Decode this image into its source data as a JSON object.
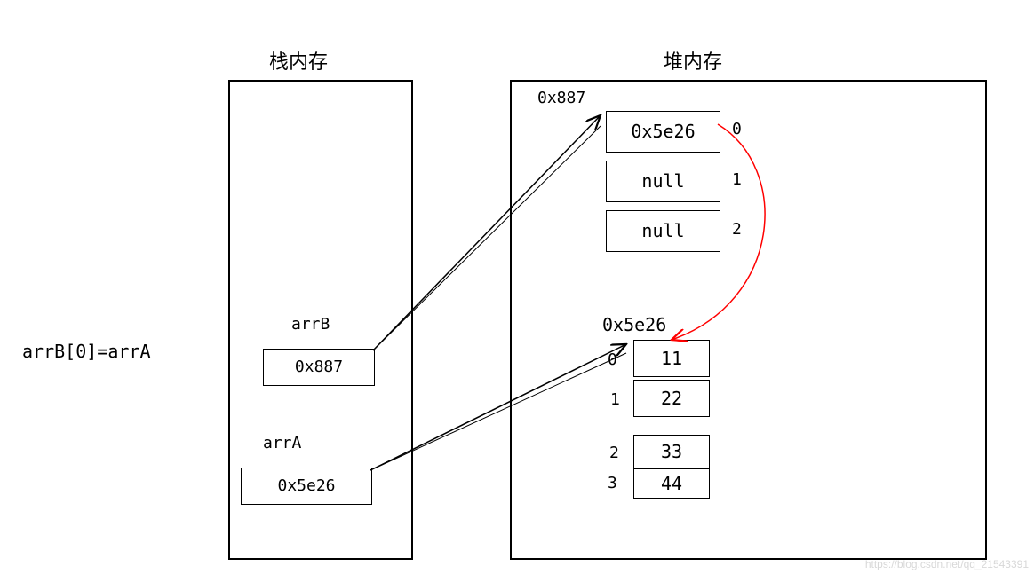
{
  "title_stack": "栈内存",
  "title_heap": "堆内存",
  "assignment": "arrB[0]=arrA",
  "stack": {
    "arrB_label": "arrB",
    "arrB_value": "0x887",
    "arrA_label": "arrA",
    "arrA_value": "0x5e26"
  },
  "heap": {
    "arrB_addr": "0x887",
    "arrB_cells": [
      {
        "value": "0x5e26",
        "index": "0"
      },
      {
        "value": "null",
        "index": "1"
      },
      {
        "value": "null",
        "index": "2"
      }
    ],
    "arrA_addr": "0x5e26",
    "arrA_cells": [
      {
        "index": "0",
        "value": "11"
      },
      {
        "index": "1",
        "value": "22"
      },
      {
        "index": "2",
        "value": "33"
      },
      {
        "index": "3",
        "value": "44"
      }
    ]
  },
  "watermark": "https://blog.csdn.net/qq_21543391"
}
